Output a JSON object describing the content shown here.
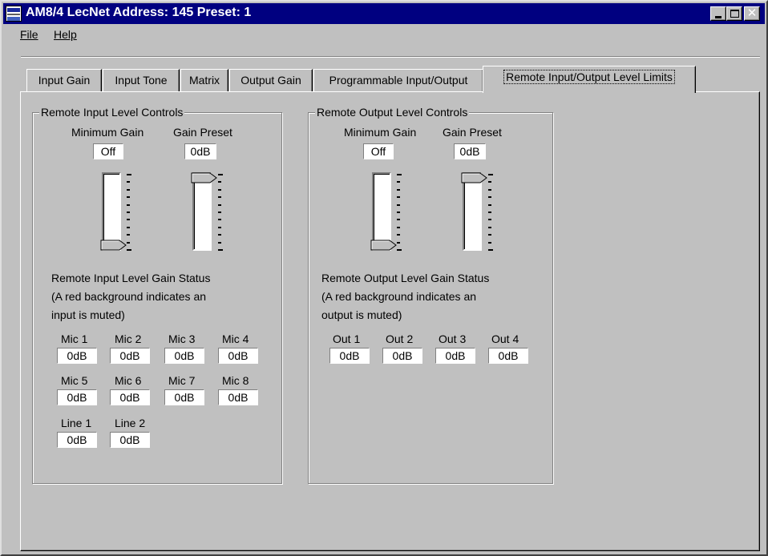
{
  "window": {
    "title": "AM8/4  LecNet Address: 145  Preset: 1",
    "close_glyph": "✕"
  },
  "menu": {
    "file": "File",
    "help": "Help"
  },
  "tabs": [
    {
      "label": "Input  Gain"
    },
    {
      "label": "Input Tone"
    },
    {
      "label": "Matrix"
    },
    {
      "label": "Output Gain"
    },
    {
      "label": "Programmable Input/Output"
    },
    {
      "label": "Remote Input/Output Level Limits",
      "active": true
    }
  ],
  "input_group": {
    "title": "Remote Input Level Controls",
    "min_gain_label": "Minimum Gain",
    "min_gain_value": "Off",
    "gain_preset_label": "Gain Preset",
    "gain_preset_value": "0dB",
    "status_title": "Remote Input Level Gain Status",
    "status_note_1": "(A red background indicates an",
    "status_note_2": "input is muted)",
    "channels": [
      {
        "name": "Mic 1",
        "value": "0dB"
      },
      {
        "name": "Mic 2",
        "value": "0dB"
      },
      {
        "name": "Mic 3",
        "value": "0dB"
      },
      {
        "name": "Mic 4",
        "value": "0dB"
      },
      {
        "name": "Mic 5",
        "value": "0dB"
      },
      {
        "name": "Mic 6",
        "value": "0dB"
      },
      {
        "name": "Mic 7",
        "value": "0dB"
      },
      {
        "name": "Mic 8",
        "value": "0dB"
      },
      {
        "name": "Line 1",
        "value": "0dB"
      },
      {
        "name": "Line 2",
        "value": "0dB"
      }
    ]
  },
  "output_group": {
    "title": "Remote Output Level Controls",
    "min_gain_label": "Minimum Gain",
    "min_gain_value": "Off",
    "gain_preset_label": "Gain Preset",
    "gain_preset_value": "0dB",
    "status_title": "Remote Output Level Gain Status",
    "status_note_1": "(A red background indicates an",
    "status_note_2": "output is muted)",
    "channels": [
      {
        "name": "Out 1",
        "value": "0dB"
      },
      {
        "name": "Out 2",
        "value": "0dB"
      },
      {
        "name": "Out 3",
        "value": "0dB"
      },
      {
        "name": "Out 4",
        "value": "0dB"
      }
    ]
  },
  "sliders": {
    "min_gain_fraction": 0.0,
    "gain_preset_fraction": 1.0
  },
  "colors": {
    "title_bar": "#000080",
    "face": "#c0c0c0",
    "field": "#ffffff"
  }
}
